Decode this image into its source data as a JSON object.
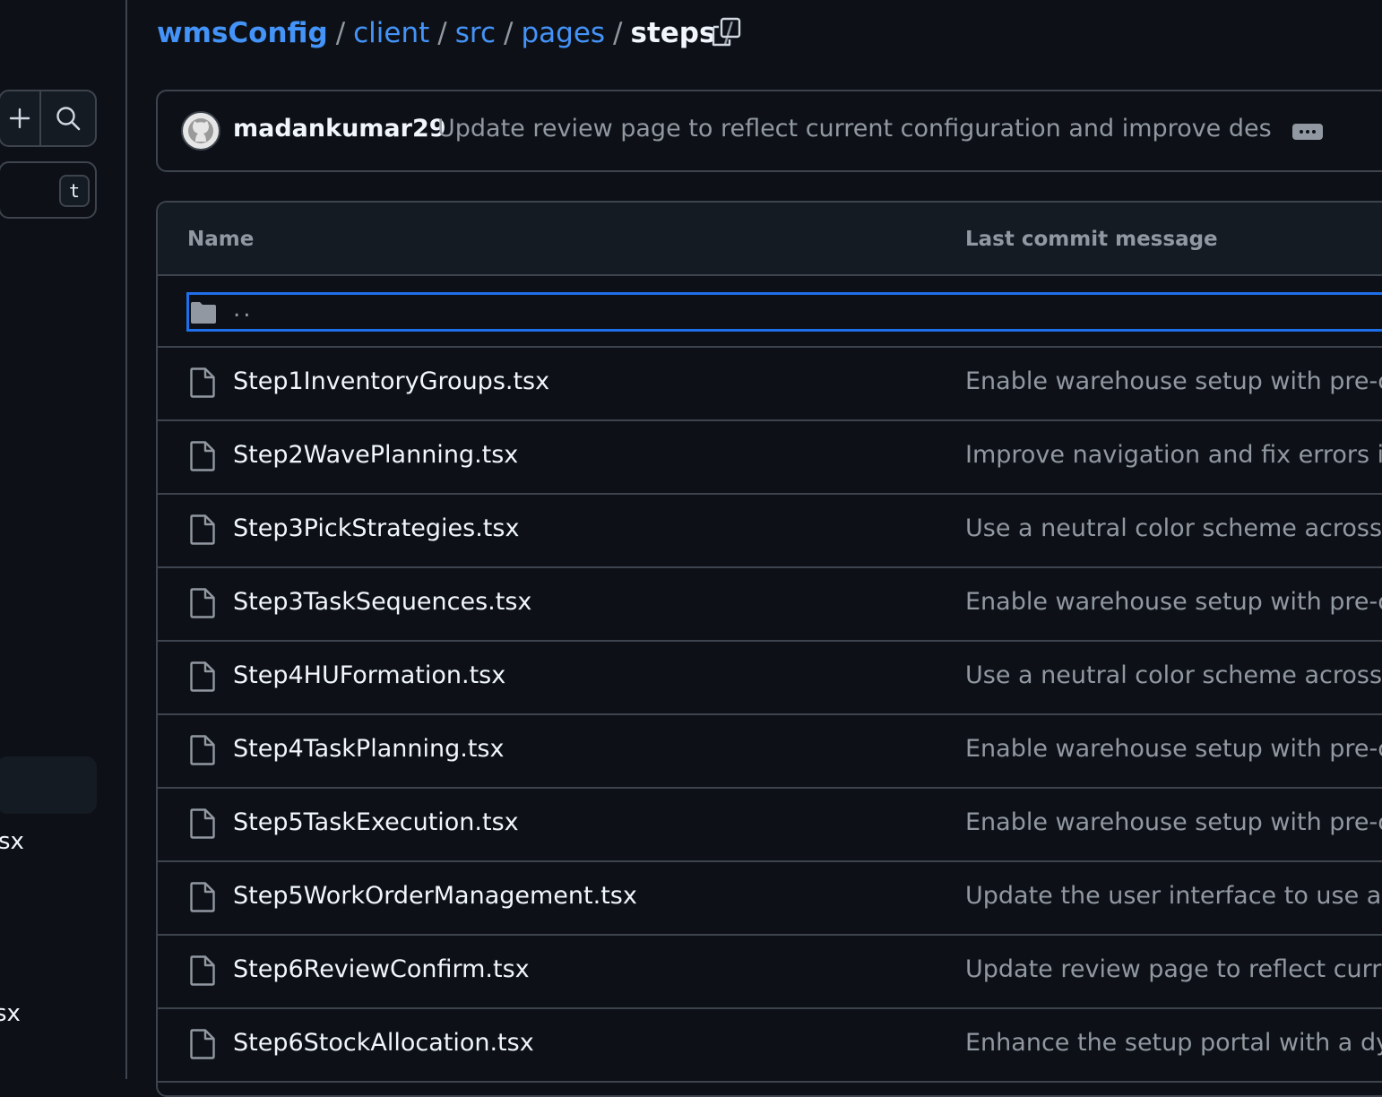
{
  "breadcrumb": {
    "root": "wmsConfig",
    "parts": [
      "client",
      "src",
      "pages"
    ],
    "current": "steps",
    "separator": "/"
  },
  "sidebar": {
    "shortcut_key": "t",
    "file_fragments": [
      "sx",
      "sx"
    ]
  },
  "latest_commit": {
    "author": "madankumar29",
    "message": "Update review page to reflect current configuration and improve descr…"
  },
  "table": {
    "columns": {
      "name": "Name",
      "last_commit_message": "Last commit message"
    },
    "parent_dir": "..",
    "rows": [
      {
        "name": "Step1InventoryGroups.tsx",
        "message": "Enable warehouse setup with pre-co"
      },
      {
        "name": "Step2WavePlanning.tsx",
        "message": "Improve navigation and fix errors in t"
      },
      {
        "name": "Step3PickStrategies.tsx",
        "message": "Use a neutral color scheme across th"
      },
      {
        "name": "Step3TaskSequences.tsx",
        "message": "Enable warehouse setup with pre-co"
      },
      {
        "name": "Step4HUFormation.tsx",
        "message": "Use a neutral color scheme across th"
      },
      {
        "name": "Step4TaskPlanning.tsx",
        "message": "Enable warehouse setup with pre-co"
      },
      {
        "name": "Step5TaskExecution.tsx",
        "message": "Enable warehouse setup with pre-co"
      },
      {
        "name": "Step5WorkOrderManagement.tsx",
        "message": "Update the user interface to use a m"
      },
      {
        "name": "Step6ReviewConfirm.tsx",
        "message": "Update review page to reflect curren"
      },
      {
        "name": "Step6StockAllocation.tsx",
        "message": "Enhance the setup portal with a dyna"
      }
    ]
  },
  "colors": {
    "background": "#0d1117",
    "link": "#4493f8",
    "muted_text": "#9198a1",
    "border": "#3d444d",
    "focus": "#1f6feb"
  }
}
